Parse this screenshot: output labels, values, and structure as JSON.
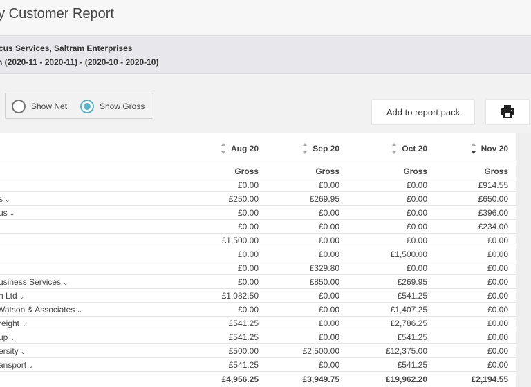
{
  "page": {
    "title": "by Customer Report"
  },
  "filters": {
    "customers_line": "cus Services, Saltram Enterprises",
    "period_line": "n (2020-11 - 2020-11) - (2020-10 - 2020-10)"
  },
  "toggle": {
    "net_label": "Show Net",
    "gross_label": "Show Gross",
    "selected": "gross"
  },
  "toolbar": {
    "report_pack_label": "Add to report pack",
    "print_icon": "printer-icon"
  },
  "table": {
    "columns": [
      {
        "label": "Aug 20",
        "sub": "Gross",
        "sort": "none"
      },
      {
        "label": "Sep 20",
        "sub": "Gross",
        "sort": "none"
      },
      {
        "label": "Oct 20",
        "sub": "Gross",
        "sort": "none"
      },
      {
        "label": "Nov 20",
        "sub": "Gross",
        "sort": "desc"
      }
    ],
    "rows": [
      {
        "name": "",
        "expandable": false,
        "values": [
          "£0.00",
          "£0.00",
          "£0.00",
          "£914.55"
        ]
      },
      {
        "name": "s",
        "expandable": true,
        "values": [
          "£250.00",
          "£269.95",
          "£0.00",
          "£650.00"
        ]
      },
      {
        "name": "us",
        "expandable": true,
        "values": [
          "£0.00",
          "£0.00",
          "£0.00",
          "£396.00"
        ]
      },
      {
        "name": "",
        "expandable": false,
        "values": [
          "£0.00",
          "£0.00",
          "£0.00",
          "£234.00"
        ]
      },
      {
        "name": "",
        "expandable": false,
        "values": [
          "£1,500.00",
          "£0.00",
          "£0.00",
          "£0.00"
        ]
      },
      {
        "name": "",
        "expandable": false,
        "values": [
          "£0.00",
          "£0.00",
          "£1,500.00",
          "£0.00"
        ]
      },
      {
        "name": "",
        "expandable": false,
        "values": [
          "£0.00",
          "£329.80",
          "£0.00",
          "£0.00"
        ]
      },
      {
        "name": "usiness Services",
        "expandable": true,
        "values": [
          "£0.00",
          "£850.00",
          "£269.95",
          "£0.00"
        ]
      },
      {
        "name": "n Ltd",
        "expandable": true,
        "values": [
          "£1,082.50",
          "£0.00",
          "£541.25",
          "£0.00"
        ]
      },
      {
        "name": " Watson & Associates",
        "expandable": true,
        "values": [
          "£0.00",
          "£0.00",
          "£1,407.25",
          "£0.00"
        ]
      },
      {
        "name": "reight",
        "expandable": true,
        "values": [
          "£541.25",
          "£0.00",
          "£2,786.25",
          "£0.00"
        ]
      },
      {
        "name": "up",
        "expandable": true,
        "values": [
          "£541.25",
          "£0.00",
          "£541.25",
          "£0.00"
        ]
      },
      {
        "name": "ersity",
        "expandable": true,
        "values": [
          "£500.00",
          "£2,500.00",
          "£12,375.00",
          "£0.00"
        ]
      },
      {
        "name": "ansport",
        "expandable": true,
        "values": [
          "£541.25",
          "£0.00",
          "£541.25",
          "£0.00"
        ]
      }
    ],
    "totals": [
      "£4,956.25",
      "£3,949.75",
      "£19,962.20",
      "£2,194.55"
    ]
  },
  "colors": {
    "accent": "#5ab4c9",
    "header_bg": "#f7f7f7",
    "filter_bg": "#e8e8ec"
  }
}
